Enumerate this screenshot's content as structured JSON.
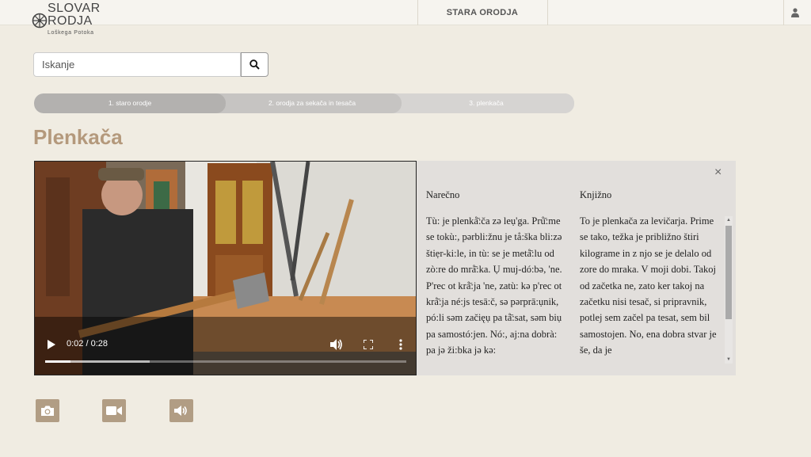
{
  "header": {
    "logo": {
      "line1": "SLOVAR",
      "line2": "RODJA",
      "line3": "Loškega Potoka"
    },
    "nav": [
      {
        "label": "STARA ORODJA"
      }
    ],
    "user_icon": "user-icon"
  },
  "search": {
    "placeholder": "Iskanje",
    "value": "",
    "button_icon": "search-icon"
  },
  "breadcrumb": [
    {
      "label": "1. staro orodje"
    },
    {
      "label": "2. orodja za sekača in tesača"
    },
    {
      "label": "3. plenkača"
    }
  ],
  "page": {
    "title": "Plenkača"
  },
  "video": {
    "time": "0:02 / 0:28",
    "progress": 0.071,
    "buffered": 0.29,
    "controls": [
      "play-icon",
      "volume-icon",
      "fullscreen-icon",
      "more-icon"
    ]
  },
  "transcript": {
    "close_icon": "close-icon",
    "close_label": "×",
    "dialect": {
      "heading": "Narečno",
      "text": "Tù: je plenkå̄:ča zə leụ'ga. Prů̄:me se tokù:, pərbli:žnu je tå:ška bli:zə štiẹr-ki:le, in tù: se je metå̄:lu od zò:re do mrå̄:ka. Ụ muj-dó:bə, 'ne. P'rec ot krå̄:ja 'ne, zatù: kə p'rec ot krå̄:ja né:js tesā:č, sə pərprā:ụnik, pó:li səm začięụ pa tå̄:sat, səm biụ pa samostó:jen. Nó:, aj:na dobrà: pa jə ži:bka jə kə:"
    },
    "literary": {
      "heading": "Knjižno",
      "text": "To je plenkača za levičarja. Prime se tako, težka je približno štiri kilograme in z njo se je delalo od zore do mraka. V moji dobi. Takoj od začetka ne, zato ker takoj na začetku nisi tesač, si pripravnik, potlej sem začel pa tesat, sem bil samostojen. No, ena dobra stvar je še, da je"
    }
  },
  "media_buttons": [
    {
      "icon": "camera-icon"
    },
    {
      "icon": "video-camera-icon"
    },
    {
      "icon": "speaker-icon"
    }
  ],
  "colors": {
    "background": "#f0ece2",
    "title": "#b4997c",
    "media_button": "#b19d84",
    "breadcrumb_active": "#b3b1af",
    "panel": "#e2dfdc"
  }
}
